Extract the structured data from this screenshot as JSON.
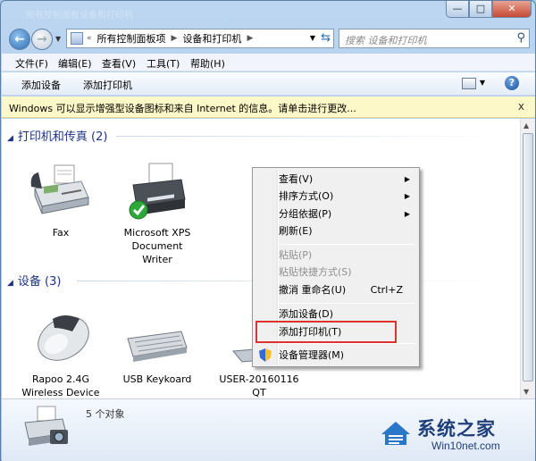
{
  "window": {
    "ghost_title_1": "所有控制面板",
    "ghost_title_2": "设备和打印机",
    "minimize": "—",
    "maximize": "□",
    "close": "✕"
  },
  "nav": {
    "breadcrumb": [
      "所有控制面板项",
      "设备和打印机"
    ],
    "breadcrumb_prefix": "«",
    "search_placeholder": "搜索 设备和打印机"
  },
  "menubar": {
    "items": [
      "文件(F)",
      "编辑(E)",
      "查看(V)",
      "工具(T)",
      "帮助(H)"
    ]
  },
  "toolbar": {
    "add_device": "添加设备",
    "add_printer": "添加打印机",
    "help": "?"
  },
  "infobar": {
    "text": "Windows 可以显示增强型设备图标和来自 Internet 的信息。请单击进行更改...",
    "close": "x"
  },
  "groups": {
    "printers": {
      "header": "打印机和传真 (2)",
      "items": [
        {
          "label": "Fax",
          "icon": "fax-icon"
        },
        {
          "label": "Microsoft XPS Document Writer",
          "label_lines": [
            "Microsoft XPS",
            "Document",
            "Writer"
          ],
          "icon": "printer-icon",
          "default": true
        }
      ]
    },
    "devices": {
      "header": "设备 (3)",
      "items": [
        {
          "label_lines": [
            "Rapoo 2.4G",
            "Wireless Device"
          ],
          "icon": "mouse-icon"
        },
        {
          "label_lines": [
            "USB Keykoard"
          ],
          "icon": "keyboard-icon"
        },
        {
          "label_lines": [
            "USER-20160116",
            "QT"
          ],
          "icon": "computer-icon"
        }
      ]
    }
  },
  "context_menu": {
    "items": [
      {
        "label": "查看(V)",
        "submenu": true
      },
      {
        "label": "排序方式(O)",
        "submenu": true
      },
      {
        "label": "分组依据(P)",
        "submenu": true
      },
      {
        "label": "刷新(E)"
      },
      {
        "label": "粘贴(P)",
        "disabled": true
      },
      {
        "label": "粘贴快捷方式(S)",
        "disabled": true
      },
      {
        "label": "撤消 重命名(U)",
        "shortcut": "Ctrl+Z"
      },
      {
        "label": "添加设备(D)"
      },
      {
        "label": "添加打印机(T)",
        "highlighted": true
      },
      {
        "label": "设备管理器(M)",
        "icon": "shield-icon"
      }
    ]
  },
  "details": {
    "count": "5 个对象"
  },
  "watermark": {
    "title": "系统之家",
    "url": "Win10net.com"
  },
  "colors": {
    "group_header": "#1e3287",
    "highlight_border": "#d9342f",
    "info_bar": "#fdf8c7"
  }
}
